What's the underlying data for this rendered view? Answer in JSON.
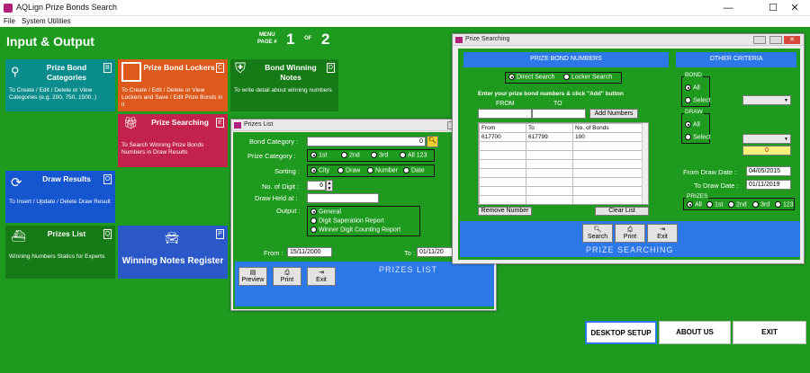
{
  "window": {
    "title": "AQLign Prize Bonds Search",
    "minimize": "—",
    "maximize": "☐",
    "close": "✕"
  },
  "menu": {
    "file": "File",
    "system": "System Utilities"
  },
  "main": {
    "title": "Input & Output",
    "menu_page_label": "MENU",
    "page_label": "PAGE #",
    "page_current": "1",
    "page_of": "OF",
    "page_total": "2"
  },
  "tiles": {
    "bond_categories": {
      "title": "Prize Bond Categories",
      "key": "B",
      "desc": "To Create / Edit / Delete or View Categories (e.g. 200, 750, 1500..)",
      "color": "#0b8c8c"
    },
    "bond_lockers": {
      "title": "Prize Bond Lockers",
      "key": "C",
      "desc": "To Create / Edit / Delete or View Lockers and Save / Edit Prize Bonds in it",
      "color": "#de5a1c"
    },
    "winning_notes": {
      "title": "Bond Winning Notes",
      "key": "D",
      "desc": "To write detail about winning numbers",
      "color": "#167a16"
    },
    "prize_searching": {
      "title": "Prize Searching",
      "key": "E",
      "desc": "To Search Winning Prize Bonds Numbers in Draw Results",
      "color": "#c2224b"
    },
    "draw_results": {
      "title": "Draw Results",
      "key": "O",
      "desc": "To Insert / Update / Delete Draw Result",
      "color": "#1555cf"
    },
    "prizes_list": {
      "title": "Prizes List",
      "key": "Q",
      "desc": "Winning Numbers Statics for Experts",
      "color": "#167a16"
    },
    "winning_register": {
      "title": "Winning Notes Register",
      "key": "P",
      "color": "#2a58c9"
    }
  },
  "prizes_list_win": {
    "title": "Prizes List",
    "bond_category_label": "Bond Category :",
    "bond_category_value": "0",
    "prize_category_label": "Prize Category :",
    "prize_options": [
      "1st",
      "2nd",
      "3rd",
      "All 123"
    ],
    "sorting_label": "Sorting :",
    "sorting_options": [
      "City",
      "Draw",
      "Number",
      "Date"
    ],
    "digits_label": "No. of Digit :",
    "digits_value": "6",
    "draw_held_label": "Draw Held at :",
    "draw_held_value": "",
    "output_label": "Output :",
    "output_options": [
      "General",
      "Digit Saperation Report",
      "Winner Digit Counting Report"
    ],
    "from_label": "From :",
    "from_value": "15/11/2000",
    "to_label": "To :",
    "to_value": "01/11/20",
    "banner": "PRIZES LIST",
    "btn_preview": "Preview",
    "btn_print": "Print",
    "btn_exit": "Exit"
  },
  "prize_search_win": {
    "title": "Prize Searching",
    "left_header": "PRIZE BOND NUMBERS",
    "right_header": "OTHER CRITERIA",
    "direct_search": "Direct Search",
    "locker_search": "Locker Search",
    "instruction": "Enter your prize bond numbers & click \"Add\" button",
    "from_label": "FROM",
    "to_label": "TO",
    "add_btn": "Add Numbers",
    "columns": [
      "From",
      "To",
      "No. of Bonds"
    ],
    "rows": [
      [
        "617700",
        "617799",
        "100"
      ]
    ],
    "remove_btn": "Remove Number",
    "clear_btn": "Clear List",
    "bond_group": "BOND",
    "bond_all": "All",
    "bond_select": "Select",
    "draw_group": "DRAW",
    "draw_all": "All",
    "draw_select": "Select",
    "draw_count": "0",
    "from_date_label": "From Draw Date :",
    "from_date": "04/05/2015",
    "to_date_label": "To Draw Date :",
    "to_date": "01/11/2019",
    "prizes_group": "PRIZES",
    "prize_opts": [
      "All",
      "1st",
      "2nd",
      "3rd",
      "123"
    ],
    "banner": "PRIZE SEARCHING",
    "btn_search": "Search",
    "btn_print": "Print",
    "btn_exit": "Exit"
  },
  "bottom": {
    "desktop_setup": "DESKTOP SETUP",
    "about_us": "ABOUT US",
    "exit": "EXIT"
  }
}
